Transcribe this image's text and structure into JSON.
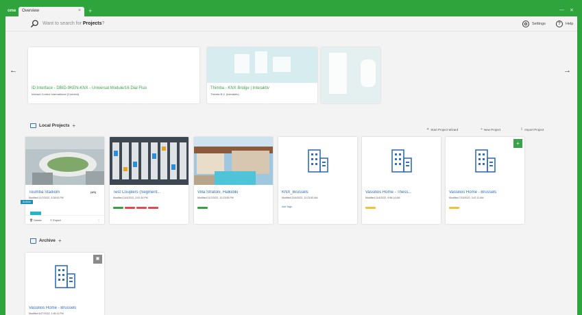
{
  "app": {
    "logo_text": "ome"
  },
  "tab": {
    "title": "Overview",
    "close": "×",
    "add": "+"
  },
  "window": {
    "minimize": "—",
    "close": "✕"
  },
  "search": {
    "prefix": "Want to search for",
    "keyword": "Projects",
    "suffix": "?"
  },
  "header": {
    "settings_label": "Settings",
    "help_label": "Help"
  },
  "carousel": {
    "prev": "←",
    "next": "→",
    "items": [
      {
        "title": "ID Interface - DBID-9KEN-KNX - Universal Module/16 Dial Fluo",
        "subtitle": "Interact Control International (Connect)"
      },
      {
        "title": "Thimba - KNX Bridge | Interaktiv",
        "subtitle": "Thimba B.V. (Interaktiv)"
      },
      {
        "title": "",
        "subtitle": ""
      }
    ]
  },
  "local_projects": {
    "title": "Local Projects",
    "add": "+",
    "actions": [
      "Start Project Wizard",
      "New Project",
      "Import Project"
    ],
    "cards": [
      {
        "title": "Toumba Stadium",
        "meta": "Modified 11/7/2022, 3:28:53 PM",
        "badge": "(4/1)",
        "bars": [
          "#25b5c6"
        ],
        "tooltip": "Archive",
        "delete": "Delete",
        "export": "Export"
      },
      {
        "title": "Test Couplers (Segment...",
        "meta": "Modified 11/4/2022, 2:02:34 PM",
        "bars": [
          "#2fa33c",
          "#e04a4a",
          "#e04a4a",
          "#e04a4a"
        ]
      },
      {
        "title": "Villa Stratoni, Halkidiki",
        "meta": "Modified 11/7/2022, 12:23:55 PM",
        "bars": [
          "#2fa33c"
        ]
      },
      {
        "title": "KNX_Brussels",
        "meta": "Modified 11/4/2022, 12:23:50 AM",
        "link": "Add Tags"
      },
      {
        "title": "Vassilios Home - Thess...",
        "meta": "Modified 11/4/2022, 9:56:14 AM",
        "bars": [
          "#f2c12e"
        ]
      },
      {
        "title": "Vassilios Home - Brussels",
        "meta": "Modified 7/15/2022, 3:47:11 AM",
        "bars": [
          "#f2c12e"
        ],
        "corner": "+"
      }
    ]
  },
  "archive": {
    "title": "Archive",
    "add": "+",
    "cards": [
      {
        "title": "Vassilios Home - Brussels",
        "meta": "Modified 6/27/2022, 1:45:11 PM",
        "corner": "▣"
      }
    ]
  }
}
